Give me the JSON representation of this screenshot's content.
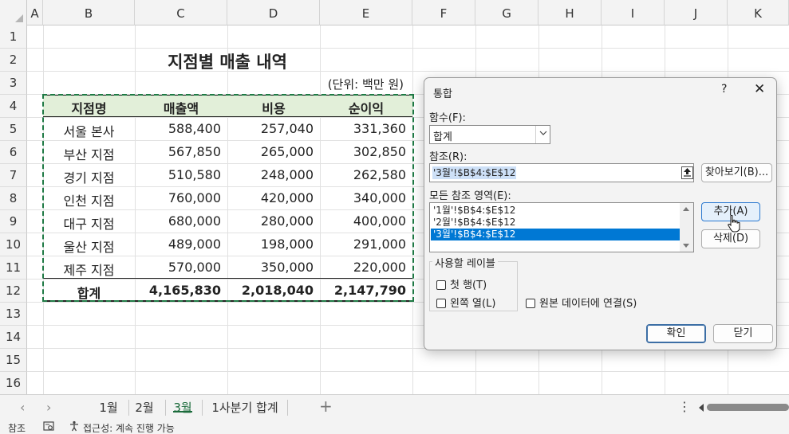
{
  "columns": [
    "A",
    "B",
    "C",
    "D",
    "E",
    "F",
    "G",
    "H",
    "I",
    "J",
    "K"
  ],
  "rows": [
    "1",
    "2",
    "3",
    "4",
    "5",
    "6",
    "7",
    "8",
    "9",
    "10",
    "11",
    "12",
    "13",
    "14",
    "15",
    "16"
  ],
  "sheet": {
    "title": "지점별 매출 내역",
    "unit": "(단위: 백만 원)",
    "headers": [
      "지점명",
      "매출액",
      "비용",
      "순이익"
    ],
    "data": [
      [
        "서울 본사",
        "588,400",
        "257,040",
        "331,360"
      ],
      [
        "부산 지점",
        "567,850",
        "265,000",
        "302,850"
      ],
      [
        "경기 지점",
        "510,580",
        "248,000",
        "262,580"
      ],
      [
        "인천 지점",
        "760,000",
        "420,000",
        "340,000"
      ],
      [
        "대구 지점",
        "680,000",
        "280,000",
        "400,000"
      ],
      [
        "울산 지점",
        "489,000",
        "198,000",
        "291,000"
      ],
      [
        "제주 지점",
        "570,000",
        "350,000",
        "220,000"
      ]
    ],
    "total": [
      "합계",
      "4,165,830",
      "2,018,040",
      "2,147,790"
    ],
    "header_fill": "#e2efd9"
  },
  "tabs": {
    "items": [
      "1월",
      "2월",
      "3월",
      "1사분기 합계"
    ],
    "active": "3월",
    "add": "+"
  },
  "status": {
    "mode": "참조",
    "accessibility": "접근성: 계속 진행 가능"
  },
  "dialog": {
    "title": "통합",
    "help": "?",
    "close": "✕",
    "function_label": "함수(F):",
    "function_value": "합계",
    "reference_label": "참조(R):",
    "reference_value": "'3월'!$B$4:$E$12",
    "browse_button": "찾아보기(B)...",
    "all_references_label": "모든 참조 영역(E):",
    "all_references": [
      "'1월'!$B$4:$E$12",
      "'2월'!$B$4:$E$12",
      "'3월'!$B$4:$E$12"
    ],
    "selected_reference_index": 2,
    "add_button": "추가(A)",
    "delete_button": "삭제(D)",
    "use_labels_group": "사용할 레이블",
    "top_row": "첫 행(T)",
    "left_column": "왼쪽 열(L)",
    "link_source": "원본 데이터에 연결(S)",
    "ok_button": "확인",
    "cancel_button": "닫기"
  },
  "colors": {
    "accent_green": "#1b6b3b",
    "selection_blue": "#0078d4"
  }
}
